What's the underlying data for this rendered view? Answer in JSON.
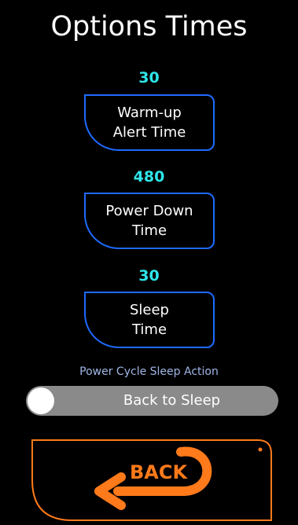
{
  "title": "Options Times",
  "options": [
    {
      "value": "30",
      "label_line1": "Warm-up",
      "label_line2": "Alert Time"
    },
    {
      "value": "480",
      "label_line1": "Power Down",
      "label_line2": "Time"
    },
    {
      "value": "30",
      "label_line1": "Sleep",
      "label_line2": "Time"
    }
  ],
  "power_cycle": {
    "label": "Power Cycle Sleep Action",
    "toggle_text": "Back to Sleep"
  },
  "back_button": {
    "label": "BACK",
    "icon": "back-arrow-icon"
  },
  "colors": {
    "background": "#000000",
    "value_text": "#2ee6ea",
    "button_border": "#1e6bff",
    "section_label": "#9fb6e6",
    "toggle_track": "#8a8a8a",
    "back_accent": "#ff7a1a"
  }
}
